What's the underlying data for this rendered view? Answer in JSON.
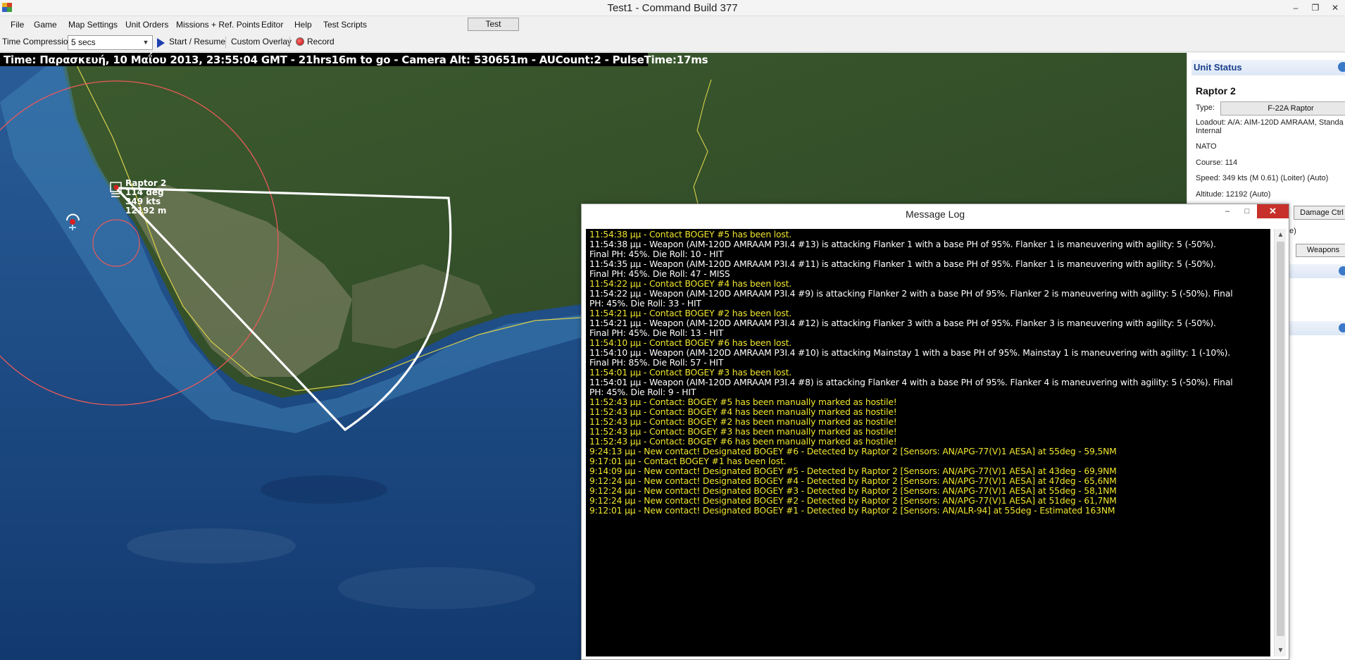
{
  "window": {
    "title": "Test1 - Command Build 377",
    "controls": [
      "minimize-icon",
      "restore-icon",
      "close-icon"
    ]
  },
  "menu": {
    "items": [
      "File",
      "Game",
      "Map Settings",
      "Unit Orders",
      "Missions + Ref. Points",
      "Editor",
      "Help",
      "Test Scripts"
    ],
    "test_button": "Test"
  },
  "toolbar": {
    "time_compression_label": "Time Compression:",
    "time_compression_value": "5 secs",
    "start_resume": "Start / Resume",
    "custom_overlay": "Custom Overlay",
    "record": "Record"
  },
  "map": {
    "info": "Time: Παρασκευή, 10 Μαΐου 2013, 23:55:04 GMT - 21hrs16m to go -  Camera Alt: 530651m - AUCount:2 - PulseTime:17ms",
    "unit_label": {
      "name": "Raptor 2",
      "course": "114 deg",
      "speed": "349 kts",
      "altitude": "12192 m"
    },
    "colors": {
      "ocean": "#1f4d86",
      "land": "#3a5a2a",
      "range_ring": "#e85a5a",
      "sensor_arc": "#ffffff",
      "border": "#d8d04a"
    }
  },
  "unit_status": {
    "header": "Unit Status",
    "name": "Raptor 2",
    "type_label": "Type:",
    "type_value": "F-22A Raptor",
    "loadout_line1": "Loadout: A/A: AIM-120D AMRAAM, Standa",
    "loadout_line2": "Internal",
    "side": "NATO",
    "course": "Course: 114",
    "speed": "Speed: 349 kts (M 0.61) (Loiter)    (Auto)",
    "altitude": "Altitude: 12192    (Auto)",
    "damage_ctrl": "Damage Ctrl",
    "partial_text": "e)",
    "weapons": "Weapons"
  },
  "message_log": {
    "title": "Message Log",
    "lines": [
      {
        "text": "11:54:38 μμ - Contact BOGEY #5 has been lost.",
        "white": false
      },
      {
        "text": "11:54:38 μμ - Weapon (AIM-120D AMRAAM P3I.4 #13) is attacking Flanker 1 with a base PH of 95%. Flanker 1 is maneuvering with agility: 5 (-50%).",
        "white": true
      },
      {
        "text": "Final PH: 45%. Die Roll: 10 - HIT",
        "white": true
      },
      {
        "text": "11:54:35 μμ - Weapon (AIM-120D AMRAAM P3I.4 #11) is attacking Flanker 1 with a base PH of 95%. Flanker 1 is maneuvering with agility: 5 (-50%).",
        "white": true
      },
      {
        "text": "Final PH: 45%. Die Roll: 47 - MISS",
        "white": true
      },
      {
        "text": "11:54:22 μμ - Contact BOGEY #4 has been lost.",
        "white": false
      },
      {
        "text": "11:54:22 μμ - Weapon (AIM-120D AMRAAM P3I.4 #9) is attacking Flanker 2 with a base PH of 95%. Flanker 2 is maneuvering with agility: 5 (-50%). Final",
        "white": true
      },
      {
        "text": "PH: 45%. Die Roll: 33 - HIT",
        "white": true
      },
      {
        "text": "11:54:21 μμ - Contact BOGEY #2 has been lost.",
        "white": false
      },
      {
        "text": "11:54:21 μμ - Weapon (AIM-120D AMRAAM P3I.4 #12) is attacking Flanker 3 with a base PH of 95%. Flanker 3 is maneuvering with agility: 5 (-50%).",
        "white": true
      },
      {
        "text": "Final PH: 45%. Die Roll: 13 - HIT",
        "white": true
      },
      {
        "text": "11:54:10 μμ - Contact BOGEY #6 has been lost.",
        "white": false
      },
      {
        "text": "11:54:10 μμ - Weapon (AIM-120D AMRAAM P3I.4 #10) is attacking Mainstay 1 with a base PH of 95%. Mainstay 1 is maneuvering with agility: 1 (-10%).",
        "white": true
      },
      {
        "text": "Final PH: 85%. Die Roll: 57 - HIT",
        "white": true
      },
      {
        "text": "11:54:01 μμ - Contact BOGEY #3 has been lost.",
        "white": false
      },
      {
        "text": "11:54:01 μμ - Weapon (AIM-120D AMRAAM P3I.4 #8) is attacking Flanker 4 with a base PH of 95%. Flanker 4 is maneuvering with agility: 5 (-50%). Final",
        "white": true
      },
      {
        "text": "PH: 45%. Die Roll: 9 - HIT",
        "white": true
      },
      {
        "text": "11:52:43 μμ - Contact: BOGEY #5 has been manually marked as hostile!",
        "white": false
      },
      {
        "text": "11:52:43 μμ - Contact: BOGEY #4 has been manually marked as hostile!",
        "white": false
      },
      {
        "text": "11:52:43 μμ - Contact: BOGEY #2 has been manually marked as hostile!",
        "white": false
      },
      {
        "text": "11:52:43 μμ - Contact: BOGEY #3 has been manually marked as hostile!",
        "white": false
      },
      {
        "text": "11:52:43 μμ - Contact: BOGEY #6 has been manually marked as hostile!",
        "white": false
      },
      {
        "text": "9:24:13 μμ - New contact! Designated BOGEY #6 - Detected by Raptor 2 [Sensors: AN/APG-77(V)1 AESA] at 55deg - 59,5NM",
        "white": false
      },
      {
        "text": "9:17:01 μμ - Contact BOGEY #1 has been lost.",
        "white": false
      },
      {
        "text": "9:14:09 μμ - New contact! Designated BOGEY #5 - Detected by Raptor 2 [Sensors: AN/APG-77(V)1 AESA] at 43deg - 69,9NM",
        "white": false
      },
      {
        "text": "9:12:24 μμ - New contact! Designated BOGEY #4 - Detected by Raptor 2 [Sensors: AN/APG-77(V)1 AESA] at 47deg - 65,6NM",
        "white": false
      },
      {
        "text": "9:12:24 μμ - New contact! Designated BOGEY #3 - Detected by Raptor 2 [Sensors: AN/APG-77(V)1 AESA] at 55deg - 58,1NM",
        "white": false
      },
      {
        "text": "9:12:24 μμ - New contact! Designated BOGEY #2 - Detected by Raptor 2 [Sensors: AN/APG-77(V)1 AESA] at 51deg - 61,7NM",
        "white": false
      },
      {
        "text": "9:12:01 μμ - New contact! Designated BOGEY #1 - Detected by Raptor 2 [Sensors: AN/ALR-94] at 55deg - Estimated 163NM",
        "white": false
      }
    ]
  }
}
